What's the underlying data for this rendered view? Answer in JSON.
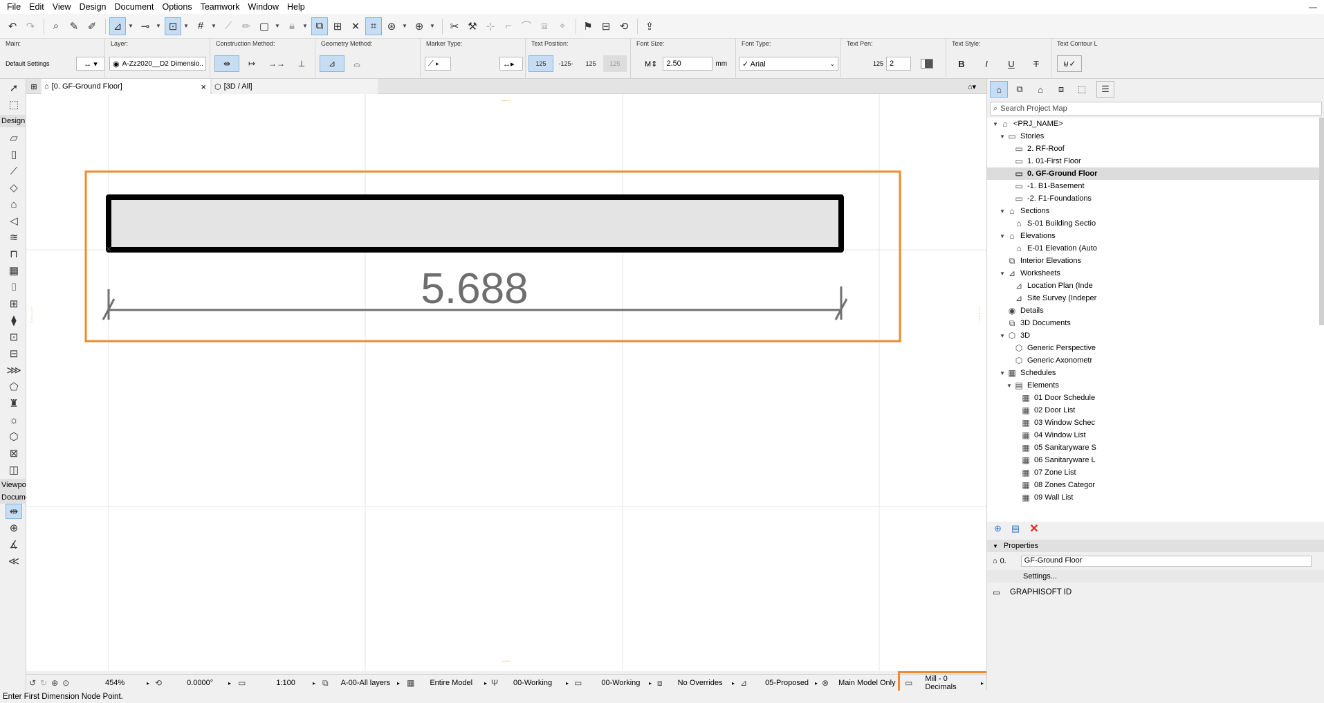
{
  "menu": [
    "File",
    "Edit",
    "View",
    "Design",
    "Document",
    "Options",
    "Teamwork",
    "Window",
    "Help"
  ],
  "window_controls": "—",
  "infobox": {
    "main_label": "Main:",
    "main_value": "Default Settings",
    "layer_label": "Layer:",
    "layer_value": "A-Zz2020__D2 Dimensio...",
    "construction_label": "Construction Method:",
    "geometry_label": "Geometry Method:",
    "marker_label": "Marker Type:",
    "text_position_label": "Text Position:",
    "text_position_options": [
      "125",
      "-125-",
      "125",
      "125"
    ],
    "font_size_label": "Font Size:",
    "font_size_value": "2.50",
    "font_size_unit": "mm",
    "font_type_label": "Font Type:",
    "font_type_value": "Arial",
    "text_pen_label": "Text Pen:",
    "text_pen_prefix": "125",
    "text_pen_value": "2",
    "text_style_label": "Text Style:",
    "text_style_buttons": [
      "B",
      "I",
      "U",
      "T"
    ],
    "text_contour_label": "Text Contour L"
  },
  "toolbox": {
    "design_header": "Design",
    "viewpoint_header": "Viewpoi",
    "document_header": "Docume"
  },
  "tabs": [
    {
      "label": "[0. GF-Ground Floor]",
      "close": "×"
    },
    {
      "label": "[3D / All]"
    }
  ],
  "canvas": {
    "dimension_text": "5.688",
    "top_marker": "----",
    "bottom_marker": "----"
  },
  "statusbar": {
    "zoom": "454%",
    "angle": "0.0000°",
    "scale": "1:100",
    "layer_combo": "A-00-All layers",
    "model_view": "Entire Model",
    "pen_set": "00-Working",
    "mvo": "00-Working",
    "graphic_override": "No Overrides",
    "renovation": "05-Proposed",
    "structure": "Main Model Only",
    "dimension": "Mill - 0 Decimals"
  },
  "prompt": "Enter First Dimension Node Point.",
  "navigator": {
    "search_placeholder": "Search Project Map",
    "tree": [
      {
        "label": "<PRJ_NAME>",
        "level": 0,
        "arrow": "down",
        "icon": "home"
      },
      {
        "label": "Stories",
        "level": 1,
        "arrow": "down",
        "icon": "folder"
      },
      {
        "label": "2. RF-Roof",
        "level": 2,
        "icon": "story"
      },
      {
        "label": "1. 01-First Floor",
        "level": 2,
        "icon": "story"
      },
      {
        "label": "0. GF-Ground Floor",
        "level": 2,
        "icon": "story",
        "selected": true
      },
      {
        "label": "-1. B1-Basement",
        "level": 2,
        "icon": "story"
      },
      {
        "label": "-2. F1-Foundations",
        "level": 2,
        "icon": "story"
      },
      {
        "label": "Sections",
        "level": 1,
        "arrow": "down",
        "icon": "section"
      },
      {
        "label": "S-01 Building Sectio",
        "level": 2,
        "icon": "section"
      },
      {
        "label": "Elevations",
        "level": 1,
        "arrow": "down",
        "icon": "section"
      },
      {
        "label": "E-01 Elevation (Auto",
        "level": 2,
        "icon": "section"
      },
      {
        "label": "Interior Elevations",
        "level": 1,
        "icon": "interior"
      },
      {
        "label": "Worksheets",
        "level": 1,
        "arrow": "down",
        "icon": "worksheet"
      },
      {
        "label": "Location Plan (Inde",
        "level": 2,
        "icon": "worksheet"
      },
      {
        "label": "Site Survey (Indeper",
        "level": 2,
        "icon": "worksheet"
      },
      {
        "label": "Details",
        "level": 1,
        "icon": "detail"
      },
      {
        "label": "3D Documents",
        "level": 1,
        "icon": "doc3d"
      },
      {
        "label": "3D",
        "level": 1,
        "arrow": "down",
        "icon": "cube"
      },
      {
        "label": "Generic Perspective",
        "level": 2,
        "icon": "cube"
      },
      {
        "label": "Generic Axonometr",
        "level": 2,
        "icon": "cube"
      },
      {
        "label": "Schedules",
        "level": 1,
        "arrow": "down",
        "icon": "schedule"
      },
      {
        "label": "Elements",
        "level": 2,
        "arrow": "down",
        "icon": "elements"
      },
      {
        "label": "01 Door Schedule",
        "level": 3,
        "icon": "schedule"
      },
      {
        "label": "02 Door List",
        "level": 3,
        "icon": "schedule"
      },
      {
        "label": "03 Window Schec",
        "level": 3,
        "icon": "schedule"
      },
      {
        "label": "04 Window List",
        "level": 3,
        "icon": "schedule"
      },
      {
        "label": "05 Sanitaryware S",
        "level": 3,
        "icon": "schedule"
      },
      {
        "label": "06 Sanitaryware L",
        "level": 3,
        "icon": "schedule"
      },
      {
        "label": "07 Zone List",
        "level": 3,
        "icon": "schedule"
      },
      {
        "label": "08 Zones Categor",
        "level": 3,
        "icon": "schedule"
      },
      {
        "label": "09 Wall List",
        "level": 3,
        "icon": "schedule"
      }
    ],
    "properties_header": "Properties",
    "properties_id": "0.",
    "properties_value": "GF-Ground Floor",
    "settings_button": "Settings...",
    "graphisoft_id": "GRAPHISOFT ID"
  },
  "colors": {
    "highlight_orange": "#f08a2c",
    "active_blue": "#c6ddf3",
    "delete_red": "#e02020"
  }
}
